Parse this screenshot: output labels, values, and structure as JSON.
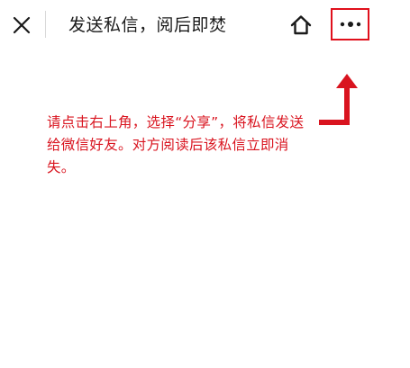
{
  "header": {
    "title": "发送私信，阅后即焚",
    "close_icon": "close-icon",
    "home_icon": "home-icon",
    "more_icon": "more-dots-icon"
  },
  "annotation": {
    "hint": "请点击右上角，选择“分享”，将私信发送给微信好友。对方阅读后该私信立即消失。",
    "highlight_color": "#e0101c",
    "text_color": "#d9141f"
  }
}
